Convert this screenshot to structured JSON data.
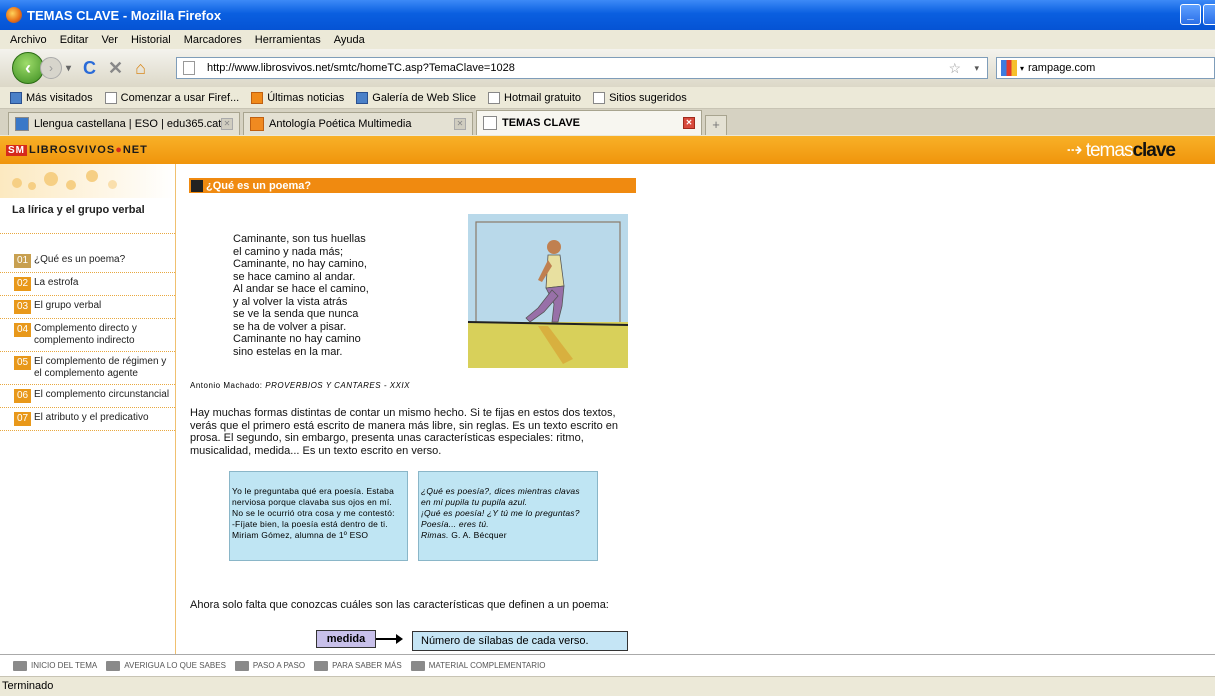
{
  "window": {
    "title": "TEMAS CLAVE - Mozilla Firefox"
  },
  "menu": [
    "Archivo",
    "Editar",
    "Ver",
    "Historial",
    "Marcadores",
    "Herramientas",
    "Ayuda"
  ],
  "nav": {
    "url": "http://www.librosvivos.net/smtc/homeTC.asp?TemaClave=1028",
    "search_value": "rampage.com"
  },
  "bookmarks": [
    "Más visitados",
    "Comenzar a usar Firef...",
    "Últimas noticias",
    "Galería de Web Slice",
    "Hotmail gratuito",
    "Sitios sugeridos"
  ],
  "tabs": [
    "Llengua castellana | ESO | edu365.cat",
    "Antología Poética Multimedia",
    "TEMAS CLAVE"
  ],
  "site": {
    "logo_sm": "SM",
    "logo_a": "LIBROSVIVOS",
    "logo_b": "NET",
    "brand_a": "temas",
    "brand_b": "clave"
  },
  "sidebar": {
    "title": "La lírica y el grupo verbal",
    "items": [
      {
        "num": "01",
        "label": "¿Qué es un poema?"
      },
      {
        "num": "02",
        "label": "La estrofa"
      },
      {
        "num": "03",
        "label": "El grupo verbal"
      },
      {
        "num": "04",
        "label": "Complemento directo y complemento indirecto"
      },
      {
        "num": "05",
        "label": "El complemento de régimen y el complemento agente"
      },
      {
        "num": "06",
        "label": "El complemento circunstancial"
      },
      {
        "num": "07",
        "label": "El atributo y el predicativo"
      }
    ]
  },
  "main": {
    "heading": "¿Qué es un poema?",
    "poem": [
      "Caminante, son tus huellas",
      "el camino y nada más;",
      "Caminante, no hay camino,",
      "se hace camino al andar.",
      "Al andar se hace el camino,",
      "y al volver la vista atrás",
      "se ve la senda que nunca",
      "se ha de volver a pisar.",
      "Caminante no hay camino",
      "sino estelas en la mar."
    ],
    "author": "Antonio Machado:",
    "author_work": "PROVERBIOS Y CANTARES - XXIX",
    "paragraph": "Hay muchas formas distintas de contar un mismo hecho. Si te fijas en estos dos textos, verás que el primero está escrito de manera más libre, sin reglas. Es un texto escrito en prosa. El segundo, sin embargo, presenta unas características especiales: ritmo, musicalidad, medida... Es un texto escrito en verso.",
    "quote1": [
      "Yo le preguntaba qué era poesía. Estaba",
      "nerviosa porque clavaba sus ojos en mí.",
      "No se le ocurrió otra cosa y me contestó:",
      "-Fíjate bien, la poesía está dentro de ti.",
      "Miriam Gómez, alumna de 1º ESO"
    ],
    "quote2": [
      "¿Qué es poesía?, dices mientras clavas",
      "en mi pupila tu pupila azul.",
      "¡Qué es poesía! ¿Y tú me lo preguntas?",
      "Poesía... eres tú.",
      "G. A. Bécquer"
    ],
    "quote2_source": "Rimas.",
    "closing": "Ahora solo falta que conozcas cuáles son las características que definen a un poema:",
    "term": "medida",
    "term_def": "Número de sílabas de cada verso."
  },
  "footer": [
    "INICIO DEL TEMA",
    "AVERIGUA LO QUE SABES",
    "PASO A PASO",
    "PARA SABER MÁS",
    "MATERIAL COMPLEMENTARIO"
  ],
  "status": "Terminado"
}
